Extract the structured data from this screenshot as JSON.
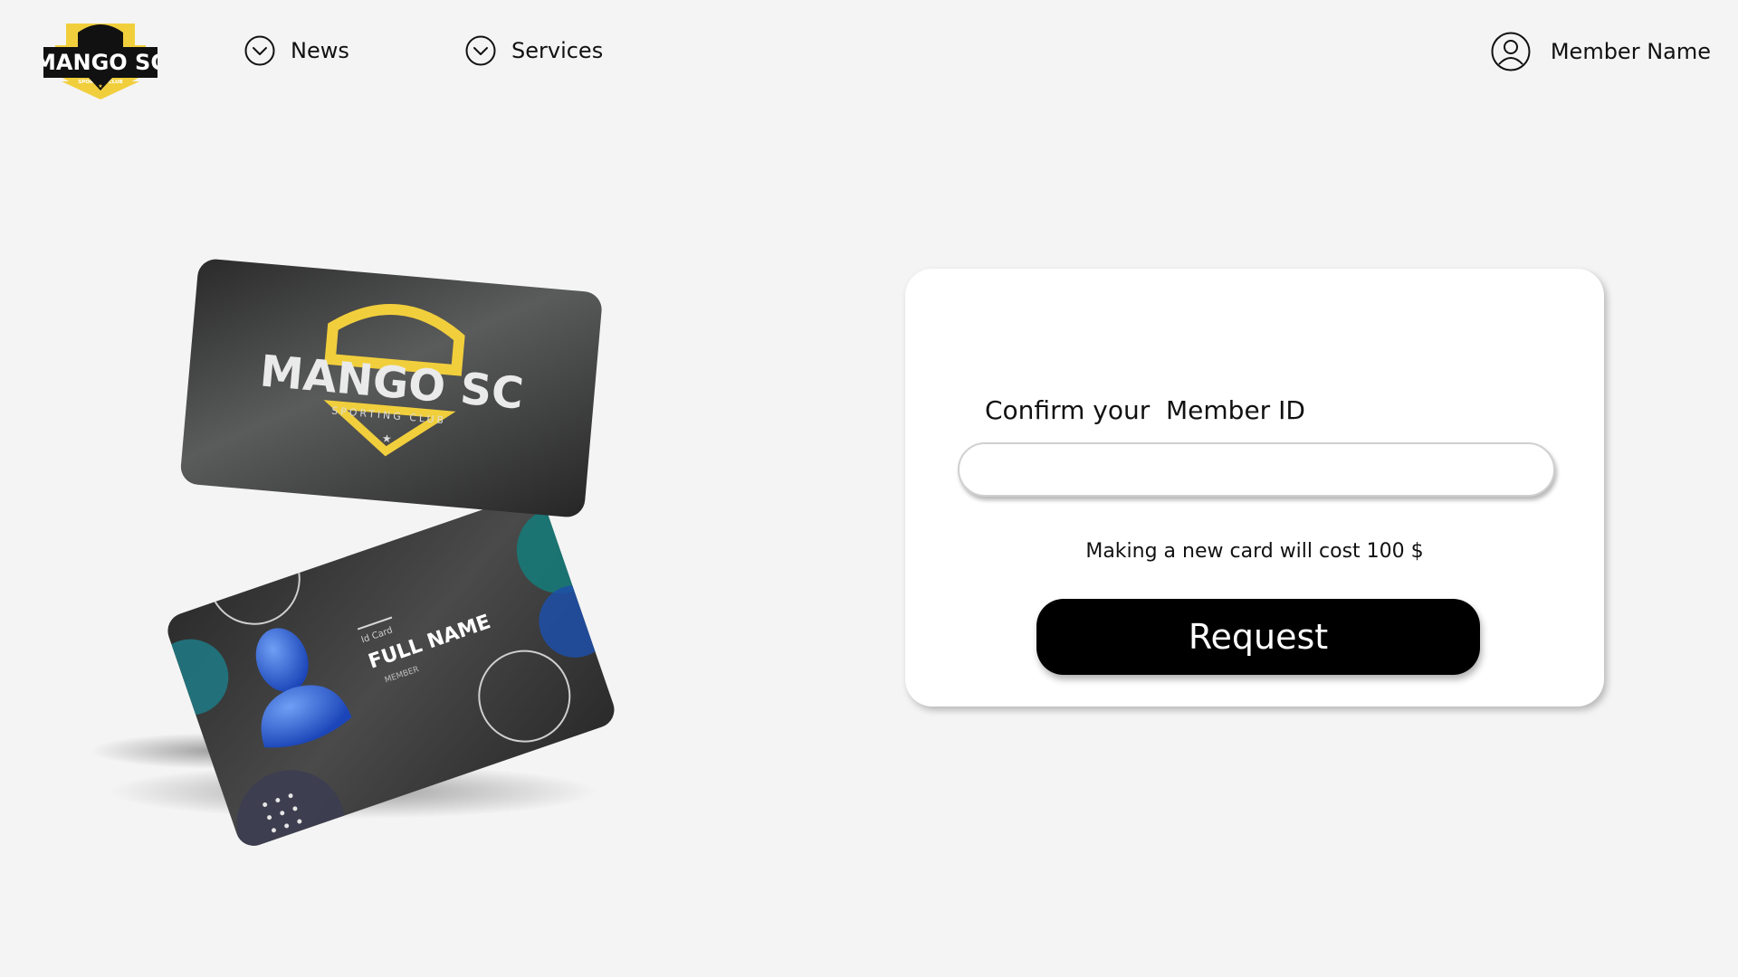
{
  "brand": {
    "name": "MANGO SC",
    "tagline": "SPORTING CLUB",
    "accent_color": "#f1cf3c"
  },
  "nav": {
    "items": [
      {
        "label": "News",
        "icon": "chevron-down-circle-icon"
      },
      {
        "label": "Services",
        "icon": "chevron-down-circle-icon"
      }
    ]
  },
  "user": {
    "name": "Member Name",
    "icon": "user-circle-icon"
  },
  "card_preview": {
    "front_brand": "MANGO SC",
    "front_tagline": "SPORTING CLUB",
    "id_label": "Id Card",
    "full_name": "FULL NAME",
    "role": "MEMBER",
    "teal_color": "#1b8c8c",
    "blue_color": "#2f6fe0"
  },
  "form": {
    "label": "Confirm your  Member ID",
    "member_id_value": "",
    "cost_note": "Making a new card will cost 100 $",
    "submit_label": "Request"
  }
}
